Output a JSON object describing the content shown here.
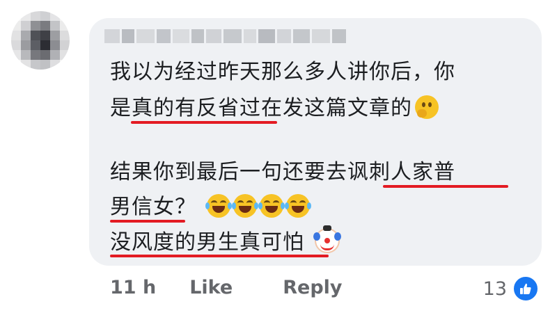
{
  "comment": {
    "author_name": "",
    "lines": [
      "我以为经过昨天那么多人讲你后，你",
      "是真的有反省过在发这篇文章的",
      "结果你到最后一句还要去讽刺人家普",
      "男信女？",
      "没风度的男生真可怕"
    ],
    "emoji_names": [
      "thinking-face-icon",
      "laughing-crying-icon",
      "clown-face-icon"
    ]
  },
  "actions": {
    "time": "11 h",
    "like_label": "Like",
    "reply_label": "Reply"
  },
  "reactions": {
    "count": "13",
    "type": "like"
  },
  "colors": {
    "bubble": "#eff1f4",
    "underline": "#e31b23",
    "action_text": "#65676b",
    "like_blue": "#1877f2"
  }
}
